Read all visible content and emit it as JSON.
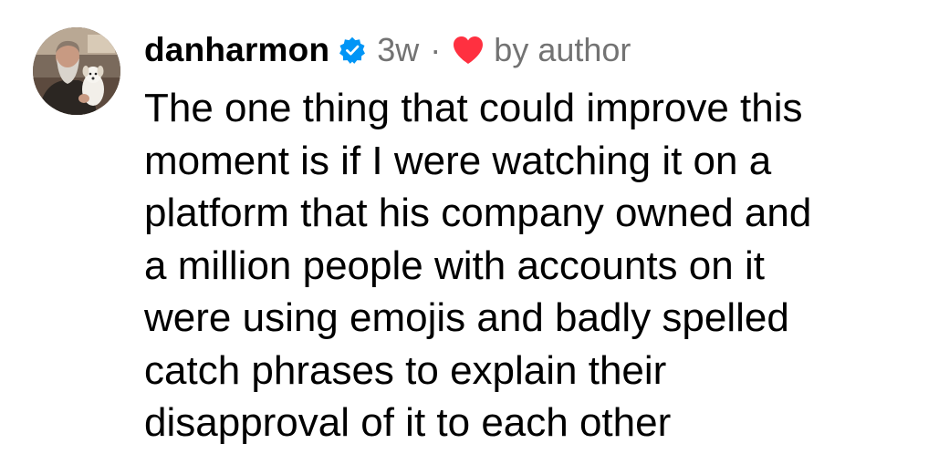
{
  "comment": {
    "avatar_icon": "profile-photo",
    "username": "danharmon",
    "verified_icon": "verified-badge-icon",
    "verified_color": "#0095f6",
    "time": "3w",
    "separator": "·",
    "heart_icon": "heart-icon",
    "heart_color": "#ff3040",
    "liked_by_label": "by author",
    "text_lines": [
      "The one thing that could improve this",
      "moment is if I were watching it on a",
      "platform that his company owned and",
      "a million people with accounts on it",
      "were using emojis and badly spelled",
      "catch phrases to explain their",
      "disapproval of it to each other"
    ]
  }
}
